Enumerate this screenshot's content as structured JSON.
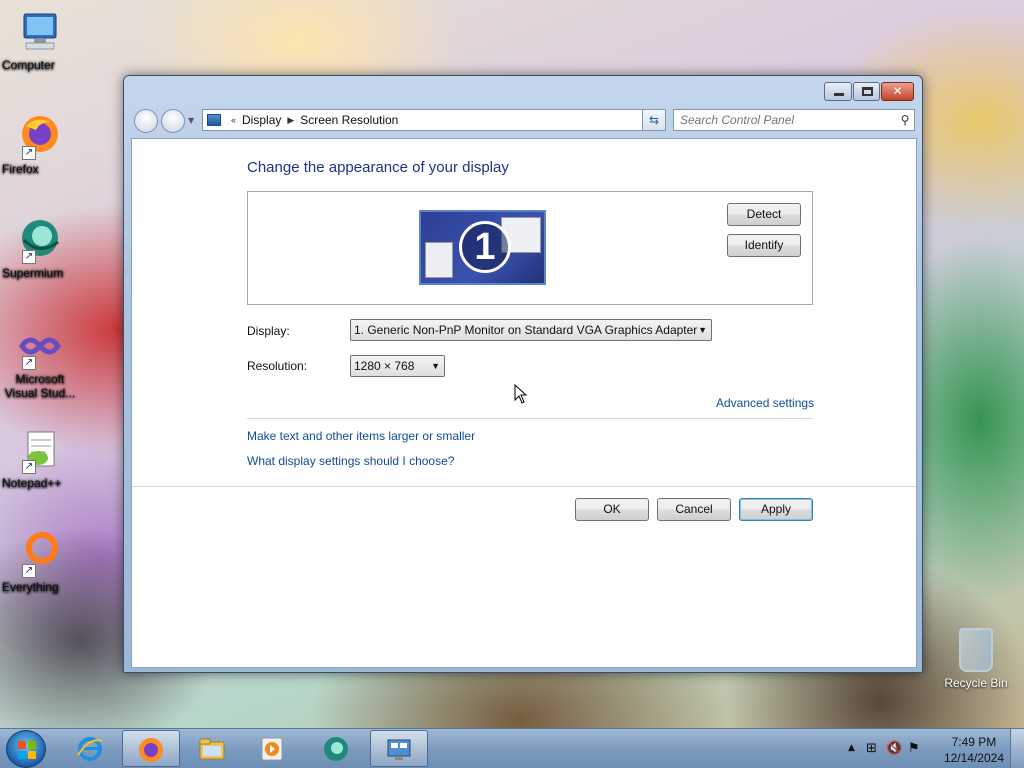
{
  "desktop": {
    "icons": [
      {
        "label": "Computer",
        "icon": "computer-icon"
      },
      {
        "label": "Firefox",
        "icon": "firefox-icon"
      },
      {
        "label": "Supermium",
        "icon": "supermium-icon"
      },
      {
        "label": "Microsoft Visual Stud...",
        "icon": "visual-studio-icon"
      },
      {
        "label": "Notepad++",
        "icon": "notepadpp-icon"
      },
      {
        "label": "Everything",
        "icon": "everything-icon"
      }
    ],
    "recycle_bin": "Recycle Bin"
  },
  "window": {
    "address": {
      "root": "Display",
      "current": "Screen Resolution"
    },
    "search_placeholder": "Search Control Panel",
    "heading": "Change the appearance of your display",
    "monitor_number": "1",
    "buttons": {
      "detect": "Detect",
      "identify": "Identify",
      "ok": "OK",
      "cancel": "Cancel",
      "apply": "Apply"
    },
    "display_label": "Display:",
    "display_value": "1. Generic Non-PnP Monitor on Standard VGA Graphics Adapter",
    "resolution_label": "Resolution:",
    "resolution_value": "1280 × 768",
    "links": {
      "advanced": "Advanced settings",
      "larger": "Make text and other items larger or smaller",
      "choose": "What display settings should I choose?"
    }
  },
  "taskbar": {
    "items": [
      "internet-explorer-icon",
      "firefox-icon",
      "explorer-folder-icon",
      "media-player-icon",
      "supermium-icon",
      "control-panel-icon"
    ],
    "clock": {
      "time": "7:49 PM",
      "date": "12/14/2024"
    }
  },
  "colors": {
    "heading": "#1e3287",
    "link": "#0f4d95",
    "taskbar": "#7e9cc0"
  }
}
